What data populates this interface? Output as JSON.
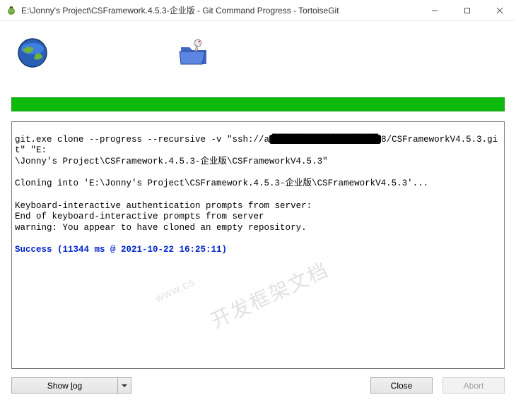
{
  "window": {
    "title": "E:\\Jonny's Project\\CSFramework.4.5.3-企业版 - Git Command Progress - TortoiseGit"
  },
  "icons": {
    "globe_name": "globe-icon",
    "folder_name": "folder-transfer-icon"
  },
  "progress": {
    "value": 100
  },
  "log": {
    "l1a": "git.exe clone --progress --recursive -v \"ssh://a",
    "l1_redacted": "████████████████████",
    "l1b": "8/CSFrameworkV4.5.3.git\" \"E:",
    "l2": "\\Jonny's Project\\CSFramework.4.5.3-企业版\\CSFrameworkV4.5.3\"",
    "l3": "Cloning into 'E:\\Jonny's Project\\CSFramework.4.5.3-企业版\\CSFrameworkV4.5.3'...",
    "l4": "Keyboard-interactive authentication prompts from server:",
    "l5": "End of keyboard-interactive prompts from server",
    "l6": "warning: You appear to have cloned an empty repository.",
    "success": "Success (11344 ms @ 2021-10-22 16:25:11)"
  },
  "watermark": {
    "line1": "www.cs",
    "line2": "开发框架文档"
  },
  "buttons": {
    "show_log": "Show log",
    "close": "Close",
    "abort": "Abort"
  }
}
